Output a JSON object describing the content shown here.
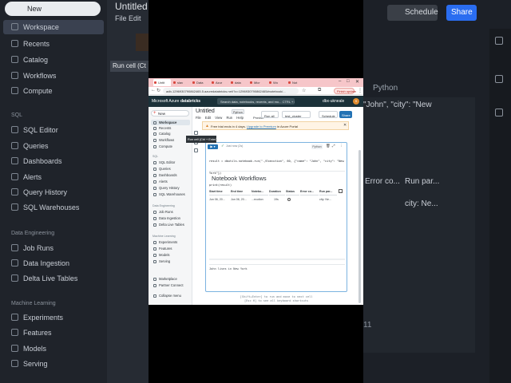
{
  "bg_left": {
    "new_label": "New",
    "items_top": [
      "Workspace",
      "Recents",
      "Catalog",
      "Workflows",
      "Compute"
    ],
    "sql_section": "SQL",
    "sql_items": [
      "SQL Editor",
      "Queries",
      "Dashboards",
      "Alerts",
      "Query History",
      "SQL Warehouses"
    ],
    "de_section": "Data Engineering",
    "de_items": [
      "Job Runs",
      "Data Ingestion",
      "Delta Live Tables"
    ],
    "ml_section": "Machine Learning",
    "ml_items": [
      "Experiments",
      "Features",
      "Models",
      "Serving"
    ],
    "title": "Untitled",
    "menu": "File   Edit",
    "tooltip": "Run cell (Ct"
  },
  "bg_right": {
    "schedule": "Schedule",
    "share": "Share",
    "python": "Python",
    "code_fragment": "\"John\", \"city\": \"New",
    "col1": "Error co...",
    "col2": "Run par...",
    "cell_value": "city: Ne...",
    "footer_digits": "11"
  },
  "browser": {
    "tabs": [
      "Untit",
      "slav",
      "Data",
      "Azur",
      "data",
      "Micr",
      "Wo",
      "Not"
    ],
    "url": "adb-1296930790862465.5.azuredatabricks.net/?o=1296930790862465#notebook/...",
    "update_label": "Finish update"
  },
  "topbar": {
    "brand": "Microsoft Azure",
    "product": "databricks",
    "search": "Search data, notebooks, recents, and mo...  CTRL + P",
    "workspace": "dbx-ukneale",
    "avatar": "S"
  },
  "sidebar": {
    "new_label": "New",
    "items": [
      "Workspace",
      "Recents",
      "Catalog",
      "Workflows",
      "Compute"
    ],
    "sql_section": "SQL",
    "sql_items": [
      "SQL Editor",
      "Queries",
      "Dashboards",
      "Alerts",
      "Query History",
      "SQL Warehouses"
    ],
    "de_section": "Data Engineering",
    "de_items": [
      "Job Runs",
      "Data Ingestion",
      "Delta Live Tables"
    ],
    "ml_section": "Machine Learning",
    "ml_items": [
      "Experiments",
      "Features",
      "Models",
      "Serving"
    ],
    "bottom_items": [
      "Marketplace",
      "Partner Connect"
    ],
    "collapse": "Collapse menu"
  },
  "notebook": {
    "title": "Untitled",
    "language": "Python",
    "menu": "File  Edit  View  Run  Help",
    "provide": "Provide",
    "run_all": "Run all",
    "cluster": "test_cluster",
    "schedule": "Schedule",
    "share": "Share",
    "banner_text": "Free trial ends in 4 days.",
    "banner_link": "Upgrade to Premium",
    "banner_tail": "in Azure Portal",
    "tooltip": "Run cell (Ctrl + Enter)",
    "cell": {
      "exec_time": "Just now (2s)",
      "lang_label": "Python",
      "code_lines": [
        "result = dbutils.notebook.run(\"./Execution\", 60, {\"name\": \"John\", \"city\": \"New",
        "York\"})",
        "print(result)"
      ],
      "output_title": "Notebook Workflows",
      "columns": [
        "Start time",
        "End time",
        "Notebo...",
        "Duration",
        "Status",
        "Error co...",
        "Run par..."
      ],
      "row": [
        "Jun 06, 20...",
        "Jun 06, 20...",
        "...ecution",
        "19s",
        "",
        "",
        "city: Ne..."
      ],
      "footer": "John lives in New York"
    },
    "hint_lines": [
      "[Shift+Enter] to run and move to next cell",
      "[Esc H] to see all keyboard shortcuts"
    ]
  }
}
